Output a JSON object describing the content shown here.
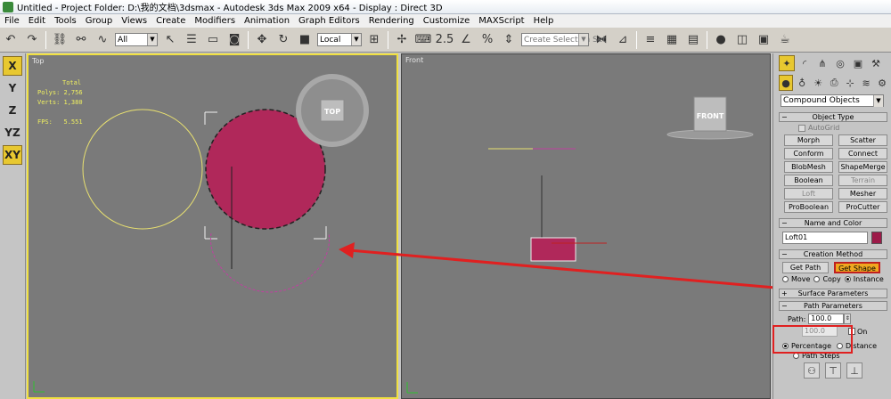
{
  "window": {
    "title": "Untitled     - Project Folder: D:\\我的文档\\3dsmax     - Autodesk 3ds Max  2009 x64      - Display : Direct 3D"
  },
  "menu": [
    "File",
    "Edit",
    "Tools",
    "Group",
    "Views",
    "Create",
    "Modifiers",
    "Animation",
    "Graph Editors",
    "Rendering",
    "Customize",
    "MAXScript",
    "Help"
  ],
  "toolbar": {
    "filter_value": "All",
    "coord_value": "Local",
    "selection_set_placeholder": "Create Selection Set"
  },
  "left_axes": [
    "X",
    "Y",
    "Z",
    "YZ",
    "XY"
  ],
  "viewport_top": {
    "label": "Top",
    "stats_label": "Total",
    "polys": "Polys: 2,756",
    "verts": "Verts: 1,380",
    "fps": "FPS:   5.551",
    "cube_label": "TOP"
  },
  "viewport_front": {
    "label": "Front",
    "cube_label": "FRONT"
  },
  "panel": {
    "category_value": "Compound Objects",
    "object_type_title": "Object Type",
    "autogrid_label": "AutoGrid",
    "object_buttons": [
      {
        "label": "Morph",
        "enabled": true
      },
      {
        "label": "Scatter",
        "enabled": true
      },
      {
        "label": "Conform",
        "enabled": true
      },
      {
        "label": "Connect",
        "enabled": true
      },
      {
        "label": "BlobMesh",
        "enabled": true
      },
      {
        "label": "ShapeMerge",
        "enabled": true
      },
      {
        "label": "Boolean",
        "enabled": true
      },
      {
        "label": "Terrain",
        "enabled": false
      },
      {
        "label": "Loft",
        "enabled": false
      },
      {
        "label": "Mesher",
        "enabled": true
      },
      {
        "label": "ProBoolean",
        "enabled": true
      },
      {
        "label": "ProCutter",
        "enabled": true
      }
    ],
    "name_color_title": "Name and Color",
    "object_name": "Loft01",
    "object_color": "#9c1a48",
    "creation_method_title": "Creation Method",
    "get_path_label": "Get Path",
    "get_shape_label": "Get Shape",
    "move_label": "Move",
    "copy_label": "Copy",
    "instance_label": "Instance",
    "surface_params_title": "Surface Parameters",
    "path_params_title": "Path Parameters",
    "path_label": "Path:",
    "path_value": "100.0",
    "snap_value": "100.0",
    "snap_on_label": "On",
    "percentage_label": "Percentage",
    "distance_label": "Distance",
    "path_steps_label": "Path Steps"
  },
  "colors": {
    "accent_yellow": "#e8c830",
    "shape_fill": "#b0285a",
    "annotation_red": "#e02020"
  }
}
